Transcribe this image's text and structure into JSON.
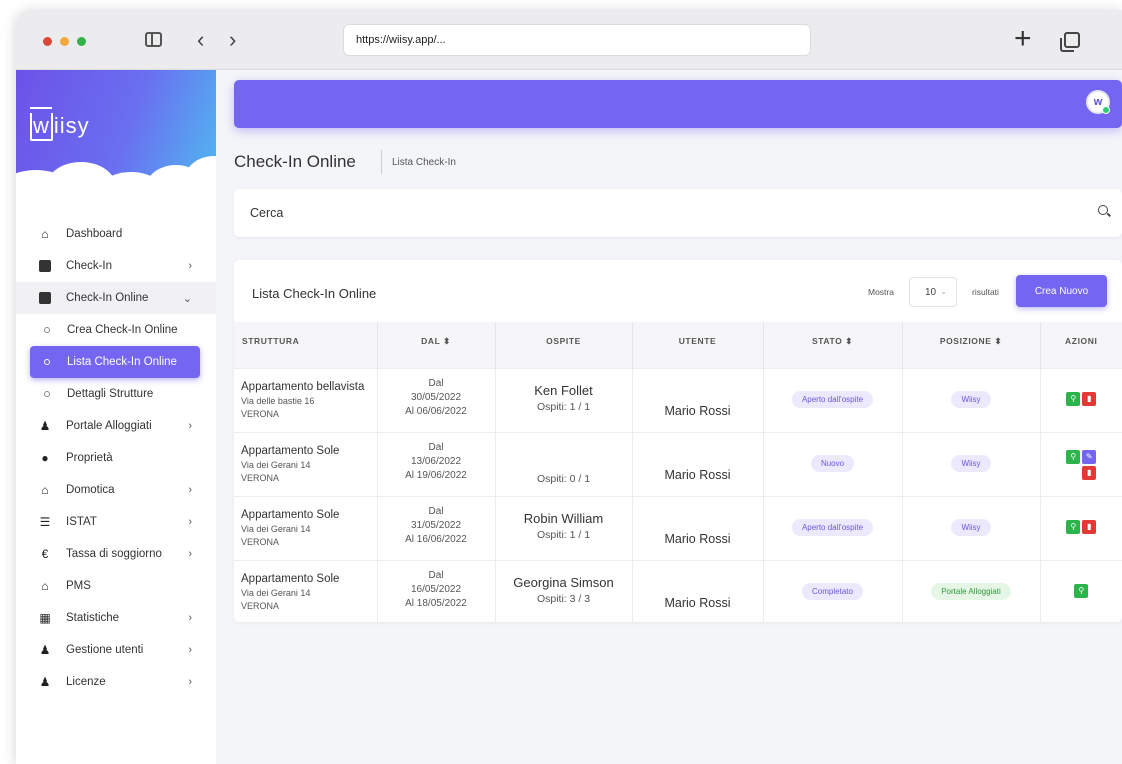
{
  "browser": {
    "url": "https://wiisy.app/..."
  },
  "brand": {
    "name": "iisy"
  },
  "sidebar": {
    "items": [
      {
        "label": "Dashboard",
        "icon": "home-icon"
      },
      {
        "label": "Check-In",
        "icon": "book-icon",
        "chevron": ">"
      },
      {
        "label": "Check-In Online",
        "icon": "calendar-check-icon",
        "chevron": "v"
      },
      {
        "label": "Portale Alloggiati",
        "icon": "people-icon",
        "chevron": ">"
      },
      {
        "label": "Proprietà",
        "icon": "map-pin-icon"
      },
      {
        "label": "Domotica",
        "icon": "smart-home-icon",
        "chevron": ">"
      },
      {
        "label": "ISTAT",
        "icon": "chart-icon",
        "chevron": ">"
      },
      {
        "label": "Tassa di soggiorno",
        "icon": "euro-icon",
        "chevron": ">"
      },
      {
        "label": "PMS",
        "icon": "building-icon"
      },
      {
        "label": "Statistiche",
        "icon": "table-icon",
        "chevron": ">"
      },
      {
        "label": "Gestione utenti",
        "icon": "users-icon",
        "chevron": ">"
      },
      {
        "label": "Licenze",
        "icon": "license-icon",
        "chevron": ">"
      }
    ],
    "subitems": [
      {
        "label": "Crea Check-In Online"
      },
      {
        "label": "Lista Check-In Online"
      },
      {
        "label": "Dettagli Strutture"
      }
    ]
  },
  "header": {
    "title": "Check-In Online",
    "breadcrumb": "Lista Check-In"
  },
  "search": {
    "placeholder": "Cerca"
  },
  "list": {
    "title": "Lista Check-In Online",
    "show_label": "Mostra",
    "page_size": "10",
    "results_label": "risultati",
    "create_button": "Crea Nuovo",
    "columns": [
      "STRUTTURA",
      "DAL  ⬍",
      "OSPITE",
      "UTENTE",
      "STATO  ⬍",
      "POSIZIONE  ⬍",
      "AZIONI"
    ],
    "rows": [
      {
        "struttura": "Appartamento bellavista",
        "indirizzo": "Via delle bastie 16",
        "citta": "VERONA",
        "dal_label": "Dal",
        "dal": "30/05/2022",
        "al": "Al 06/06/2022",
        "ospite": "Ken Follet",
        "ospiti": "Ospiti: 1 / 1",
        "utente": "Mario Rossi",
        "stato": "Aperto dall'ospite",
        "posizione": "Wiisy"
      },
      {
        "struttura": "Appartamento Sole",
        "indirizzo": "Via dei Gerani 14",
        "citta": "VERONA",
        "dal_label": "Dal",
        "dal": "13/06/2022",
        "al": "Al 19/06/2022",
        "ospite": "",
        "ospiti": "Ospiti: 0 / 1",
        "utente": "Mario Rossi",
        "stato": "Nuovo",
        "posizione": "Wiisy"
      },
      {
        "struttura": "Appartamento Sole",
        "indirizzo": "Via dei Gerani 14",
        "citta": "VERONA",
        "dal_label": "Dal",
        "dal": "31/05/2022",
        "al": "Al 16/06/2022",
        "ospite": "Robin William",
        "ospiti": "Ospiti: 1 / 1",
        "utente": "Mario Rossi",
        "stato": "Aperto dall'ospite",
        "posizione": "Wiisy"
      },
      {
        "struttura": "Appartamento Sole",
        "indirizzo": "Via dei Gerani 14",
        "citta": "VERONA",
        "dal_label": "Dal",
        "dal": "16/05/2022",
        "al": "Al 18/05/2022",
        "ospite": "Georgina Simson",
        "ospiti": "Ospiti: 3 / 3",
        "utente": "Mario Rossi",
        "stato": "Completato",
        "posizione": "Portale Alloggiati"
      }
    ]
  },
  "colors": {
    "accent": "#7466f1",
    "view": "#2bb54a",
    "delete": "#e53935"
  }
}
